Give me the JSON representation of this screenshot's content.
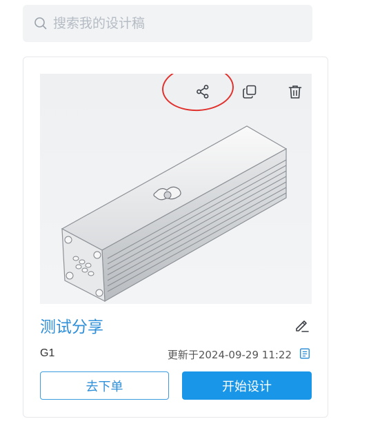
{
  "search": {
    "placeholder": "搜索我的设计稿",
    "value": ""
  },
  "card": {
    "title": "测试分享",
    "code": "G1",
    "updated": "更新于2024-09-29 11:22",
    "order_button": "去下单",
    "design_button": "开始设计",
    "actions": [
      "share-icon",
      "copy-icon",
      "delete-icon"
    ],
    "highlight_color": "#e0312d",
    "accent_color": "#1a96e8"
  }
}
